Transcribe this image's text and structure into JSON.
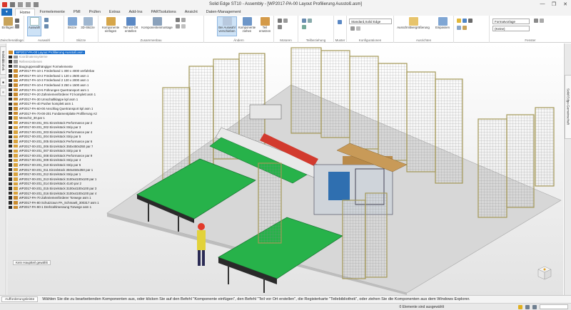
{
  "window": {
    "title": "Solid Edge ST10 - Assembly - [WP2017-PA-00 Layout Profilierung Ausstoß.asm]",
    "controls": [
      "—",
      "❐",
      "✕"
    ]
  },
  "ribbon_tabs": [
    "Home",
    "Formelemente",
    "PMI",
    "Prüfen",
    "Extras",
    "Add-Ins",
    "PARTsolutions",
    "Ansicht",
    "Daten-Management"
  ],
  "ribbon": {
    "groups": {
      "zwischenablage": "Zwischenablage",
      "auswahl": "Auswahl",
      "skizze": "Skizze",
      "zusammenbau": "Zusammenbau",
      "ändern": "Ändern",
      "motoren": "Motoren",
      "teilbeziehung": "Teilbeziehung",
      "muster": "Muster",
      "konfigurationen": "Konfigurationen",
      "ausrichten": "Ausrichten",
      "fenster": "Fenster"
    },
    "buttons": {
      "einfügen": "Einfügen",
      "auswahl": "Auswahl",
      "skizze": "Skizze",
      "skizze_3d": "3D-Skizze",
      "komponente_einfügen": "Komponente einfügen",
      "teil_vor_ort": "Teil vor Ort erstellen",
      "komponentenmontage": "Komponentenmontage",
      "bei_auswahl": "Bei Auswahl verschieben",
      "komponente_ziehen": "Komponente ziehen",
      "teil_ersetzen": "Teil ersetzen",
      "ausschnitt": "Ausschnittvergrößerung",
      "einpassen": "Einpassen"
    },
    "combos": {
      "konfiguration": "Standard,Solid Edge",
      "formatvorlage": "Formatvorlage",
      "keine": "(Keine)"
    }
  },
  "docks": {
    "left_tab": "Teilebibliothek",
    "right_tab": "Solid Edge-Gemeinschaft"
  },
  "pathfinder": {
    "items": [
      {
        "label": "WP2017-PA-00 Layout Profilierung Ausstoß.asm",
        "kind": "hdr"
      },
      {
        "label": "Koordinatensysteme",
        "kind": "dim"
      },
      {
        "label": "Referenzebenen",
        "kind": "dim"
      },
      {
        "label": "Baugruppenabhängiger Formelemente",
        "kind": "grey"
      },
      {
        "label": "WP2017-PA-10-1 Förderband 1 300 x 4000 verfahrbar",
        "kind": "part"
      },
      {
        "label": "WP2017-PA-10-2 Förderband 1 120 x 2500 asm 1",
        "kind": "part"
      },
      {
        "label": "WP2017-PA-10-3 Förderband 2 120 x 2000 asm 1",
        "kind": "part"
      },
      {
        "label": "WP2017-PA-10-4 Förderband 3 250 x 1500 asm 1",
        "kind": "part"
      },
      {
        "label": "WP2017-PA-10-5 Führungen Quertransport asm 1",
        "kind": "part"
      },
      {
        "label": "WP2017-PA-20 Zahnriemenförderer F2 komplett asm 1",
        "kind": "part"
      },
      {
        "label": "WP2017-PA-30 Umschaltklappe kpl asm 1",
        "kind": "part"
      },
      {
        "label": "WP2017-PA-40 Pusher komplett asm 1",
        "kind": "part"
      },
      {
        "label": "WP2017-PA-60-00 Anschlag Quertransport kpl asm 1",
        "kind": "part"
      },
      {
        "label": "WP2017-PA-70-00-201 Fundamentplatte Profilierung A2",
        "kind": "part"
      },
      {
        "label": "Mensch2_30.par 1",
        "kind": "doc"
      },
      {
        "label": "WP2017-00-201_001 Einzelstück Performance par 2",
        "kind": "doc"
      },
      {
        "label": "WP2017-00-201_002 Einzelstück Strip par 3",
        "kind": "doc"
      },
      {
        "label": "WP2017-00-201_003 Einzelstück Performance par 4",
        "kind": "doc"
      },
      {
        "label": "WP2017-00-201_004 Einzelstück Strip par 5",
        "kind": "doc"
      },
      {
        "label": "WP2017-00-201_005 Einzelstück Performance par 6",
        "kind": "doc"
      },
      {
        "label": "WP2017-00-201_006 Einzelstück 350x450x350 par 7",
        "kind": "doc"
      },
      {
        "label": "WP2017-00-201_007 Einzelstück Strip par 8",
        "kind": "doc"
      },
      {
        "label": "WP2017-00-201_008 Einzelstück Performance par 9",
        "kind": "doc"
      },
      {
        "label": "WP2017-00-201_009 Einzelstück Strip par 4",
        "kind": "doc"
      },
      {
        "label": "WP2017-00-201_010 Einzelstück Strip par 5",
        "kind": "doc"
      },
      {
        "label": "WP2017-00-201_011 Einzelstück 350x450x350 par 1",
        "kind": "doc"
      },
      {
        "label": "WP2017-00-201_012 Einzelstück Strip par 1",
        "kind": "doc"
      },
      {
        "label": "WP2017-00-201_013 Einzelstück 3100x4100x100 par 1",
        "kind": "doc"
      },
      {
        "label": "WP2017-00-201_014 Einzelstück 4140 par 2",
        "kind": "doc"
      },
      {
        "label": "WP2017-00-201_015 Einzelstück 3100x4100x100 par 3",
        "kind": "doc"
      },
      {
        "label": "WP2017-00-201_016 Einzelstück 3100x4100x100 par 4",
        "kind": "doc"
      },
      {
        "label": "WP2017-PA-70 Zahnriemenförderer Torwege asm 1",
        "kind": "part"
      },
      {
        "label": "WP2017-PA-80 Schutzzaun PA_Schmaelt_300317 asm 1",
        "kind": "part"
      },
      {
        "label": "WP2017-PA-90-1 Drehzahlmessung Torwege asm 1",
        "kind": "part"
      }
    ],
    "status": "Kein Hauptteil gewählt"
  },
  "command_bar": {
    "label": "Aufforderungsleiste",
    "prompt": "Wählen Sie die zu bearbeitenden Komponenten aus, oder klicken Sie auf den Befehl \"Komponente einfügen\", den Befehl \"Teil vor Ort erstellen\", die Registerkarte \"Teilebibliothek\", oder ziehen Sie die Komponenten aus dem Windows Explorer."
  },
  "status_bar": {
    "selection": "0 Elemente sind ausgewählt"
  },
  "colors": {
    "accent": "#1e6fbf",
    "conveyor": "#27b24a",
    "fence": "#b9ab6c",
    "floor": "#d8d8d8"
  }
}
